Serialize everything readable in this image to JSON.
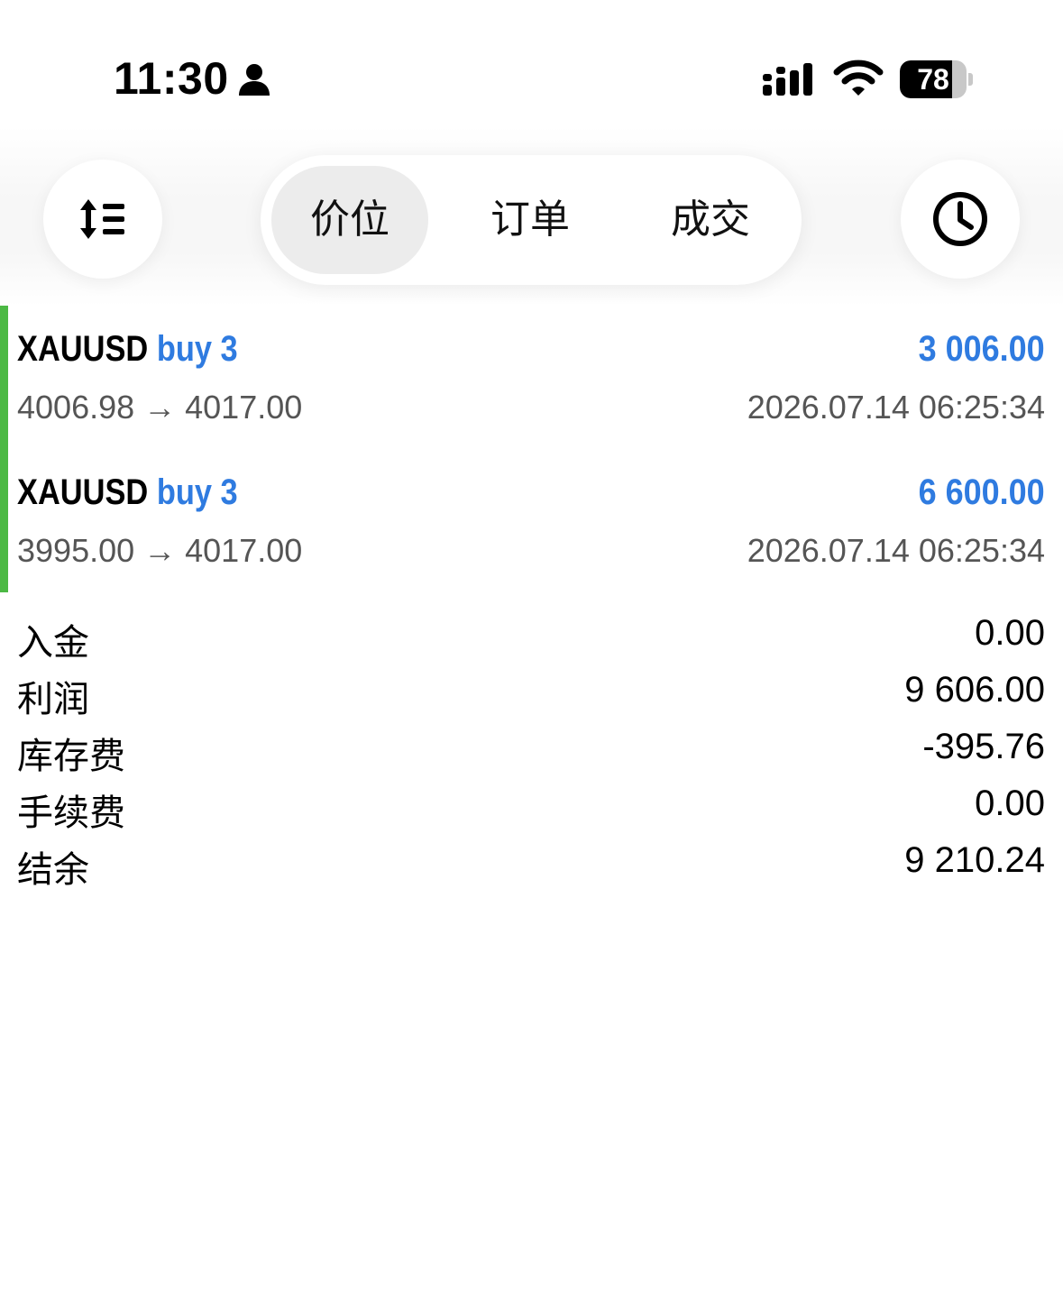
{
  "status_bar": {
    "time": "11:30",
    "battery": "78",
    "battery_level": 0.78,
    "icons": [
      "person-icon",
      "signal-icon",
      "wifi-icon",
      "battery-icon"
    ]
  },
  "toolbar": {
    "left_icon": "sort-icon",
    "right_icon": "clock-icon",
    "tabs": [
      {
        "label": "价位",
        "active": true
      },
      {
        "label": "订单",
        "active": false
      },
      {
        "label": "成交",
        "active": false
      }
    ]
  },
  "deals": [
    {
      "symbol": "XAUUSD",
      "direction": "buy 3",
      "profit": "3 006.00",
      "prices": "4006.98 → 4017.00",
      "datetime": "2026.07.14 06:25:34"
    },
    {
      "symbol": "XAUUSD",
      "direction": "buy 3",
      "profit": "6 600.00",
      "prices": "3995.00 → 4017.00",
      "datetime": "2026.07.14 06:25:34"
    }
  ],
  "colors": {
    "accent_blue": "#2f7be0",
    "indicator_green": "#4cb944",
    "secondary_text": "#555555"
  },
  "summary": [
    {
      "label": "入金",
      "value": "0.00"
    },
    {
      "label": "利润",
      "value": "9 606.00"
    },
    {
      "label": "库存费",
      "value": "-395.76"
    },
    {
      "label": "手续费",
      "value": "0.00"
    },
    {
      "label": "结余",
      "value": "9 210.24"
    }
  ]
}
